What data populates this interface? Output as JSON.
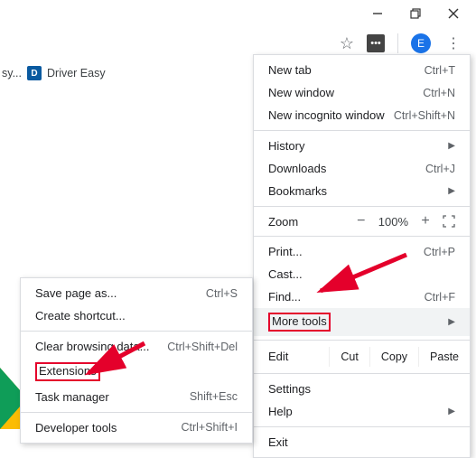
{
  "window": {
    "minimize_title": "Minimize",
    "maximize_title": "Restore",
    "close_title": "Close"
  },
  "toolbar": {
    "star_title": "Bookmark this page",
    "ext_badge": "•••",
    "avatar_initial": "E",
    "kebab_title": "Customize and control Google Chrome"
  },
  "bookmarks": {
    "item0_suffix": "sy...",
    "item1_label": "Driver Easy",
    "item1_icon_letter": "D"
  },
  "menu": {
    "new_tab": "New tab",
    "new_tab_sc": "Ctrl+T",
    "new_window": "New window",
    "new_window_sc": "Ctrl+N",
    "incognito": "New incognito window",
    "incognito_sc": "Ctrl+Shift+N",
    "history": "History",
    "downloads": "Downloads",
    "downloads_sc": "Ctrl+J",
    "bookmarks": "Bookmarks",
    "zoom_label": "Zoom",
    "zoom_minus": "−",
    "zoom_value": "100%",
    "zoom_plus": "+",
    "print": "Print...",
    "print_sc": "Ctrl+P",
    "cast": "Cast...",
    "find": "Find...",
    "find_sc": "Ctrl+F",
    "more_tools": "More tools",
    "edit_label": "Edit",
    "cut": "Cut",
    "copy": "Copy",
    "paste": "Paste",
    "settings": "Settings",
    "help": "Help",
    "exit": "Exit"
  },
  "submenu": {
    "save_page": "Save page as...",
    "save_page_sc": "Ctrl+S",
    "create_shortcut": "Create shortcut...",
    "clear_data": "Clear browsing data...",
    "clear_data_sc": "Ctrl+Shift+Del",
    "extensions": "Extensions",
    "task_manager": "Task manager",
    "task_manager_sc": "Shift+Esc",
    "dev_tools": "Developer tools",
    "dev_tools_sc": "Ctrl+Shift+I"
  }
}
